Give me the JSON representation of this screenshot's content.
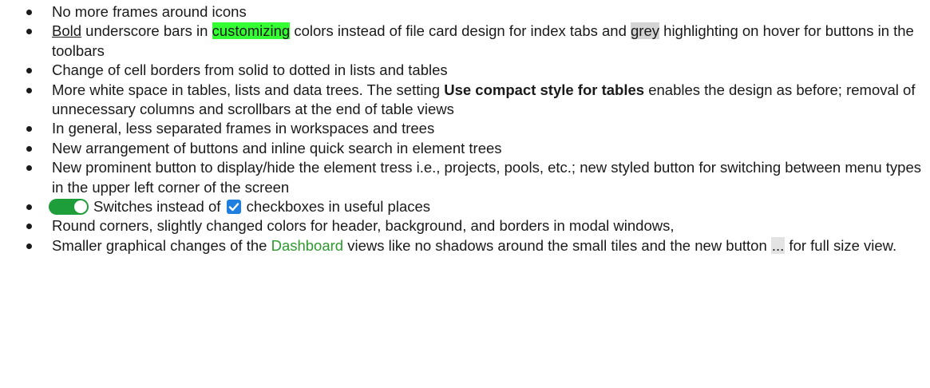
{
  "bullets": {
    "item1": {
      "text": "No more frames around icons"
    },
    "item2": {
      "bold_u": "Bold",
      "t1": " underscore bars in ",
      "hl1": "customizing",
      "t2": " colors instead of file card design for index tabs and ",
      "hl2": "grey",
      "t3": " highlighting on hover for buttons in the toolbars"
    },
    "item3": {
      "text": "Change of cell borders from solid to dotted in lists and tables"
    },
    "item4": {
      "t1": "More white space in tables, lists and data trees. The setting ",
      "bold": "Use compact style for tables",
      "t2": " enables the design as before; removal of unnecessary columns and scrollbars at the end of table views"
    },
    "item5": {
      "text": "In general, less separated frames in workspaces and trees"
    },
    "item6": {
      "text": "New arrangement of buttons and inline quick search in element trees"
    },
    "item7": {
      "text": "New prominent button to display/hide the element tress i.e., projects, pools, etc.; new styled button for switching between menu types in the upper left corner of the screen"
    },
    "item8": {
      "t1": "Switches instead of ",
      "t2": " checkboxes in useful places"
    },
    "item9": {
      "text": "Round corners, slightly changed colors for header, background, and borders in modal windows,"
    },
    "item10": {
      "t1": "Smaller graphical changes of the ",
      "link": "Dashboard",
      "t2": " views like no shadows around the small tiles and the new button ",
      "btn": "...",
      "t3": " for full size view."
    }
  },
  "icons": {
    "switch": "toggle-switch-icon",
    "checkbox": "checked-checkbox-icon"
  },
  "colors": {
    "highlight_green": "#33ff33",
    "highlight_grey": "#d4d4d4",
    "dashboard_link": "#2e9a2e",
    "switch_on": "#1e9e3a",
    "checkbox": "#1f7fe0"
  }
}
